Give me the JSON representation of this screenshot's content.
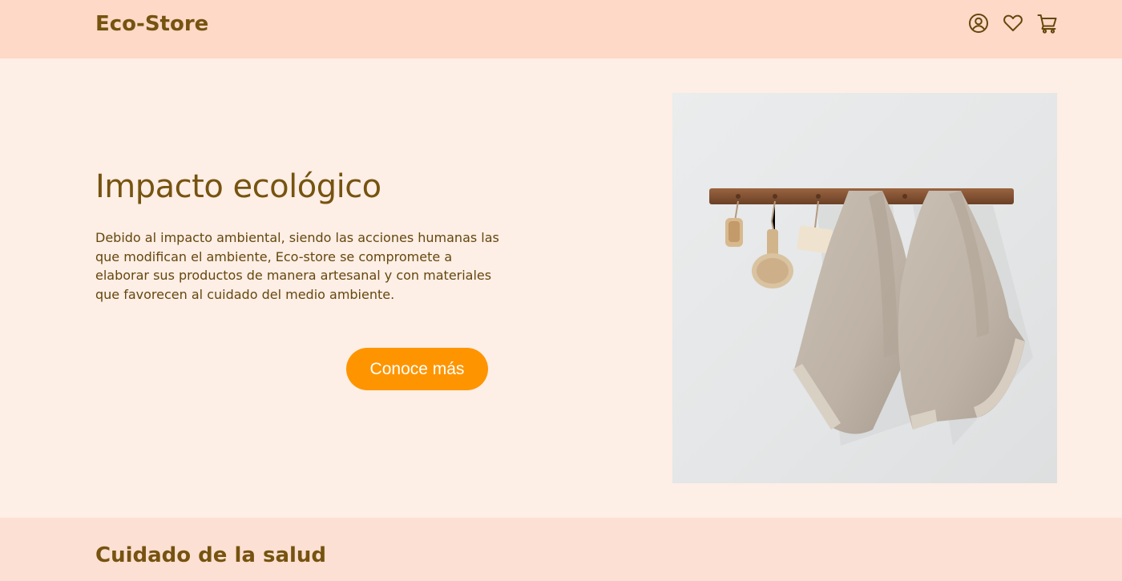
{
  "header": {
    "brand": "Eco-Store",
    "icons": [
      "user-circle-icon",
      "heart-icon",
      "cart-icon"
    ]
  },
  "hero": {
    "title": "Impacto ecológico",
    "description": "Debido al impacto ambiental, siendo las acciones humanas las que modifican el ambiente, Eco-store se compromete a elaborar sus productos de manera artesanal y con materiales que favorecen al cuidado del medio ambiente.",
    "cta_label": "Conoce más",
    "image": "towels-hanging-on-wooden-rack-photo"
  },
  "section": {
    "title": "Cuidado de la salud"
  },
  "colors": {
    "header_bg": "#fed9c7",
    "page_bg": "#fdeee6",
    "section_bg": "#fde0d4",
    "brand_text": "#76530f",
    "accent": "#fe9500"
  }
}
